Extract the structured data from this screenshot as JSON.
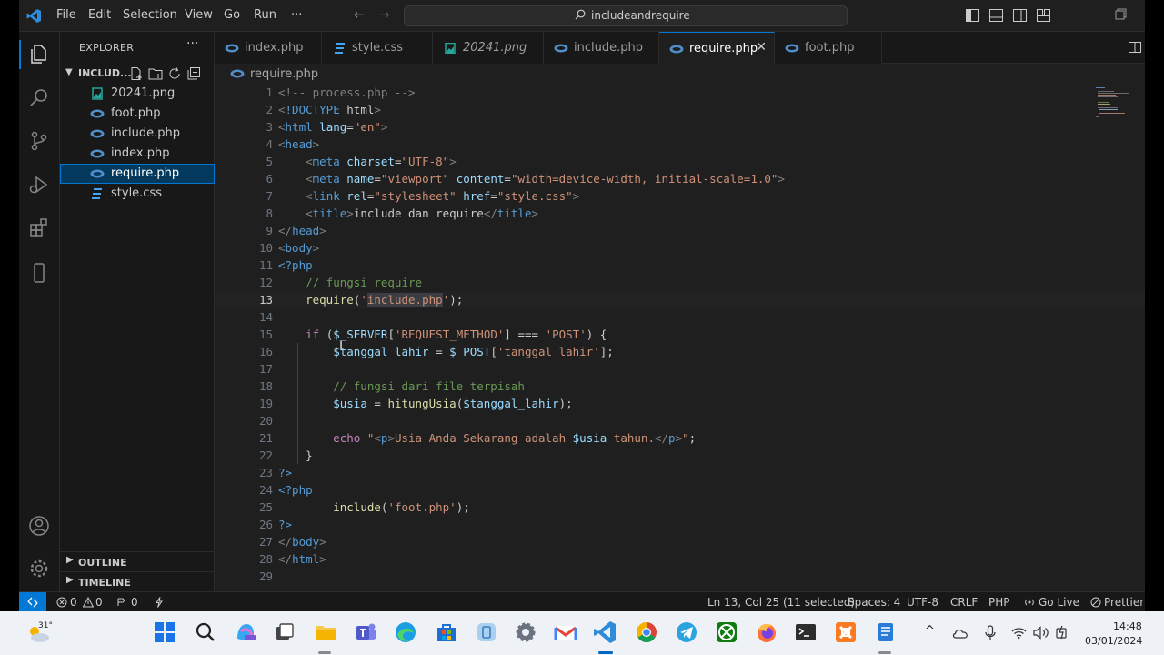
{
  "menu": {
    "items": [
      "File",
      "Edit",
      "Selection",
      "View",
      "Go",
      "Run"
    ],
    "more": "···"
  },
  "search": {
    "label": "includeandrequire"
  },
  "explorer": {
    "title": "EXPLORER",
    "more": "···",
    "folder_name": "INCLUD...",
    "files": [
      {
        "name": "20241.png",
        "type": "image"
      },
      {
        "name": "foot.php",
        "type": "php"
      },
      {
        "name": "include.php",
        "type": "php"
      },
      {
        "name": "index.php",
        "type": "php"
      },
      {
        "name": "require.php",
        "type": "php",
        "active": true
      },
      {
        "name": "style.css",
        "type": "css"
      }
    ],
    "outline": "OUTLINE",
    "timeline": "TIMELINE"
  },
  "tabs": [
    {
      "label": "index.php",
      "type": "php"
    },
    {
      "label": "style.css",
      "type": "css"
    },
    {
      "label": "20241.png",
      "type": "image"
    },
    {
      "label": "include.php",
      "type": "php"
    },
    {
      "label": "require.php",
      "type": "php",
      "active": true
    },
    {
      "label": "foot.php",
      "type": "php"
    }
  ],
  "breadcrumb": {
    "file": "require.php"
  },
  "editor": {
    "current_line": 13,
    "line_numbers": [
      "1",
      "2",
      "3",
      "4",
      "5",
      "6",
      "7",
      "8",
      "9",
      "10",
      "11",
      "12",
      "13",
      "14",
      "15",
      "16",
      "17",
      "18",
      "19",
      "20",
      "21",
      "22",
      "23",
      "24",
      "25",
      "26",
      "27",
      "28",
      "29"
    ],
    "lines": [
      "<!-- process.php -->",
      "<!DOCTYPE html>",
      "<html lang=\"en\">",
      "<head>",
      "    <meta charset=\"UTF-8\">",
      "    <meta name=\"viewport\" content=\"width=device-width, initial-scale=1.0\">",
      "    <link rel=\"stylesheet\" href=\"style.css\">",
      "    <title>include dan require</title>",
      "</head>",
      "<body>",
      "<?php",
      "    // fungsi require",
      "    require('include.php');",
      "",
      "    if ($_SERVER['REQUEST_METHOD'] === 'POST') {",
      "        $tanggal_lahir = $_POST['tanggal_lahir'];",
      "",
      "        // fungsi dari file terpisah",
      "        $usia = hitungUsia($tanggal_lahir);",
      "",
      "        echo \"<p>Usia Anda Sekarang adalah $usia tahun.</p>\";",
      "    }",
      "?>",
      "<?php",
      "        include('foot.php');",
      "?>",
      "</body>",
      "</html>",
      ""
    ]
  },
  "status": {
    "errors": "0",
    "warnings": "0",
    "ports": "0",
    "position": "Ln 13, Col 25 (11 selected)",
    "spaces": "Spaces: 4",
    "encoding": "UTF-8",
    "eol": "CRLF",
    "language": "PHP",
    "golive": "Go Live",
    "prettier": "Prettier"
  },
  "taskbar": {
    "weather_temp": "31°",
    "time": "14:48",
    "date": "03/01/2024"
  },
  "colors": {
    "accent": "#0078d4",
    "editor_bg": "#1f1f1f",
    "sidebar_bg": "#181818",
    "taskbar_bg": "#eef1f6"
  }
}
